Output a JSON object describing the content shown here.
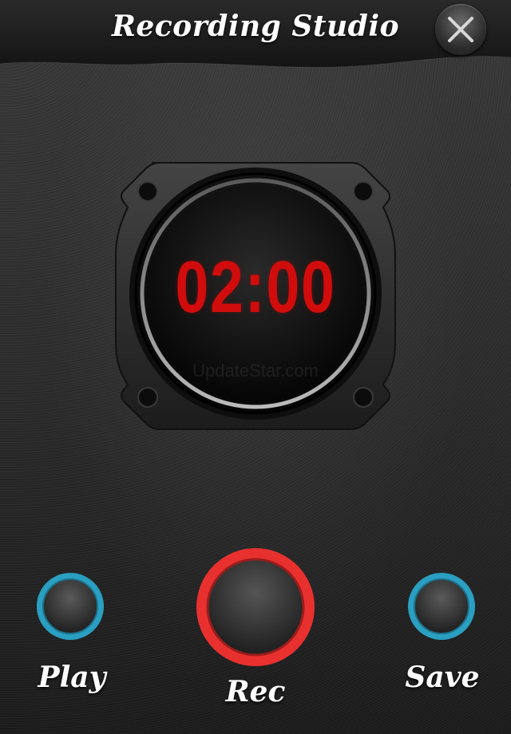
{
  "header": {
    "title": "Recording Studio",
    "close_icon": "close-x-icon"
  },
  "timer": {
    "display": "02:00",
    "watermark": "UpdateStar.com",
    "digit_color": "#d10c0c"
  },
  "controls": {
    "play": {
      "label": "Play",
      "ring_color": "#2a9fc2"
    },
    "rec": {
      "label": "Rec",
      "ring_color": "#e8312f"
    },
    "save": {
      "label": "Save",
      "ring_color": "#2a9fc2"
    }
  }
}
